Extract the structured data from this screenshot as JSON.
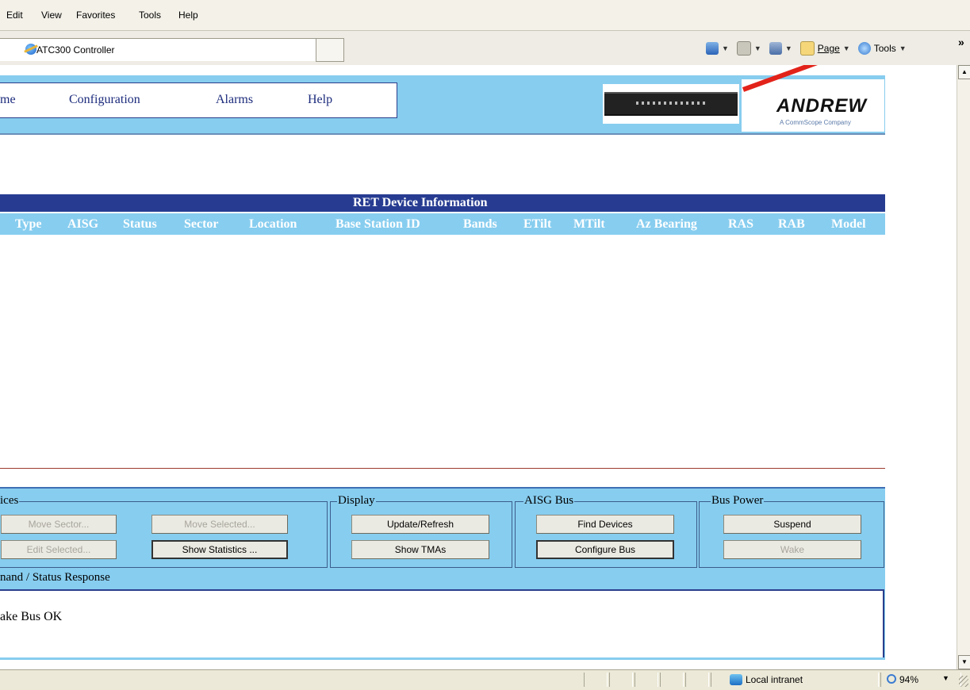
{
  "browser": {
    "menu": [
      "Edit",
      "View",
      "Favorites",
      "Tools",
      "Help"
    ],
    "tab_title": "ATC300 Controller",
    "command_bar": {
      "page_label": "Page",
      "tools_label": "Tools"
    },
    "status": {
      "zone": "Local intranet",
      "zoom": "94%"
    }
  },
  "nav": {
    "home_label": "me",
    "configuration_label": "Configuration",
    "alarms_label": "Alarms",
    "help_label": "Help"
  },
  "logo": {
    "name": "ANDREW",
    "tagline": "A CommScope Company"
  },
  "table": {
    "title": "RET Device Information",
    "columns": [
      "Type",
      "AISG",
      "Status",
      "Sector",
      "Location",
      "Base Station ID",
      "Bands",
      "ETilt",
      "MTilt",
      "Az Bearing",
      "RAS",
      "RAB",
      "Model"
    ],
    "rows": []
  },
  "devices_group": {
    "legend": "ices",
    "move_sector": "Move Sector...",
    "move_selected": "Move Selected...",
    "edit_selected": "Edit Selected...",
    "show_statistics": "Show Statistics ..."
  },
  "display_group": {
    "legend": "Display",
    "update_refresh": "Update/Refresh",
    "show_tmas": "Show TMAs"
  },
  "aisg_group": {
    "legend": "AISG Bus",
    "find_devices": "Find Devices",
    "configure_bus": "Configure Bus"
  },
  "power_group": {
    "legend": "Bus Power",
    "suspend": "Suspend",
    "wake": "Wake"
  },
  "response": {
    "label": "nand / Status Response",
    "text": "ake Bus OK"
  },
  "colors": {
    "header_blue": "#87cdef",
    "title_navy": "#273c91",
    "nav_text": "#1c2b7c"
  }
}
